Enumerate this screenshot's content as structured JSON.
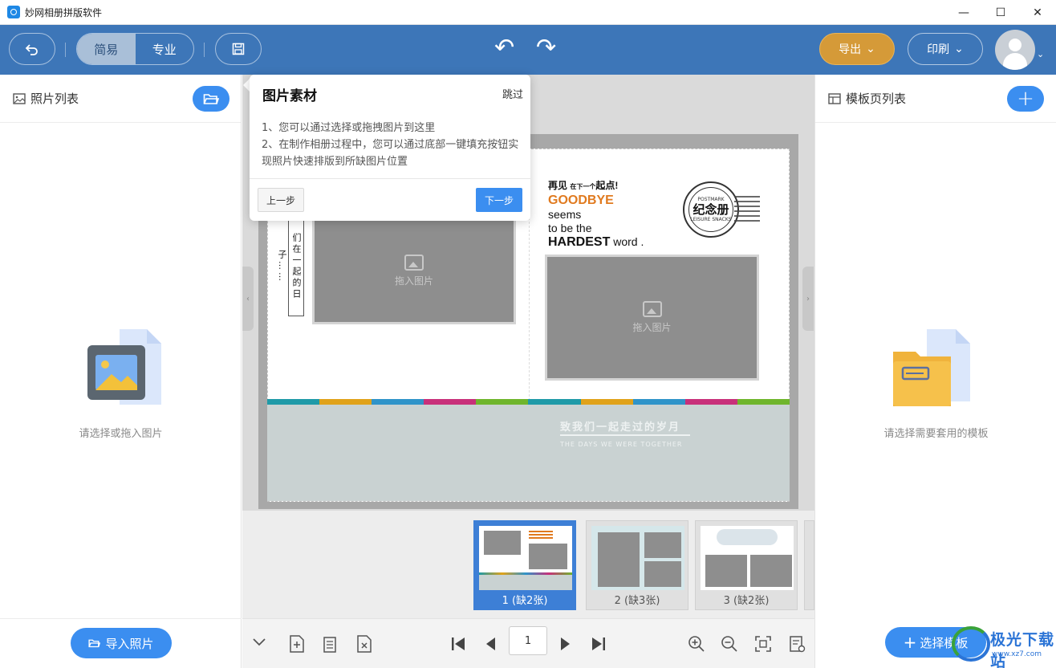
{
  "app": {
    "title": "妙网相册拼版软件"
  },
  "window_controls": {
    "minimize": "—",
    "maximize": "☐",
    "close": "✕"
  },
  "toolbar": {
    "back_icon": "undo-arrow-icon",
    "mode_simple": "简易",
    "mode_pro": "专业",
    "active_mode": "简易",
    "save_icon": "save-icon",
    "undo_glyph": "↶",
    "redo_glyph": "↷",
    "export_label": "导出",
    "print_label": "印刷",
    "caret": "⌄"
  },
  "left_panel": {
    "title": "照片列表",
    "empty_text": "请选择或拖入图片",
    "import_label": "导入照片"
  },
  "right_panel": {
    "title": "模板页列表",
    "empty_text": "请选择需要套用的模板",
    "select_label": "选择模板",
    "plus": "+"
  },
  "popover": {
    "title": "图片素材",
    "skip": "跳过",
    "line1": "1、您可以通过选择或拖拽图片到这里",
    "line2": "2、在制作相册过程中，您可以通过底部一键填充按钮实现照片快速排版到所缺图片位置",
    "prev": "上一步",
    "next": "下一步"
  },
  "canvas": {
    "slot_label": "拖入图片",
    "vertical_text": "们在一起的日子……",
    "goodbye": {
      "line1_a": "再见",
      "line1_b": "在下一个",
      "line1_c": "起点!",
      "line2": "GOODBYE",
      "line3": "seems",
      "line4": "to be the",
      "line5_bold": "HARDEST",
      "line5_rest": " word ."
    },
    "stamp": {
      "top": "POSTMARK",
      "center": "纪念册",
      "bottom": "LEISURE SNACKS"
    },
    "band_title": "致我们一起走过的岁月",
    "band_sub": "THE DAYS WE WERE TOGETHER",
    "strip_colors": [
      "#1f9aa8",
      "#e0a21a",
      "#2f94c9",
      "#c8307a",
      "#6fb52c",
      "#1f9aa8",
      "#e0a21a",
      "#2f94c9",
      "#c8307a",
      "#6fb52c"
    ]
  },
  "thumbnails": [
    {
      "caption": "1 (缺2张)",
      "active": true
    },
    {
      "caption": "2 (缺3张)",
      "active": false
    },
    {
      "caption": "3 (缺2张)",
      "active": false
    }
  ],
  "bottom_bar": {
    "page_number": "1"
  },
  "watermark": {
    "text": "极光下载站",
    "sub": "www.xz7.com"
  },
  "colors": {
    "accent": "#3b8ef0",
    "toolbar": "#3d76b8",
    "export": "#d59a38"
  }
}
